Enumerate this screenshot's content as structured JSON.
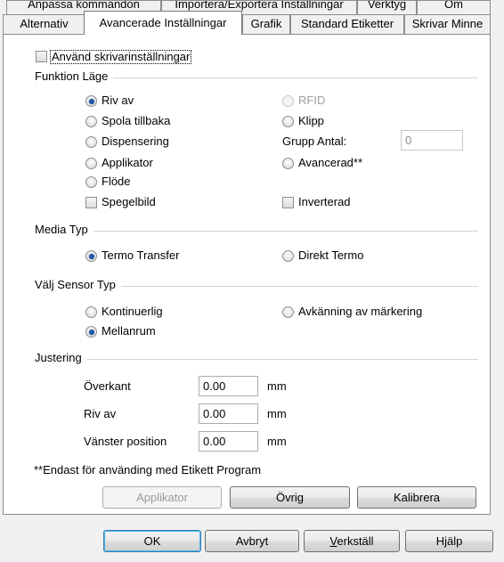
{
  "tabs_back": [
    "Anpassa kommandon",
    "Importera/Exportera Inställningar",
    "Verktyg",
    "Om"
  ],
  "tabs_front": [
    "Alternativ",
    "Avancerade Inställningar",
    "Grafik",
    "Standard Etiketter",
    "Skrivar Minne"
  ],
  "active_tab": "Avancerade Inställningar",
  "use_printer_settings": {
    "label": "Använd skrivarinställningar",
    "checked": false
  },
  "function_mode": {
    "title": "Funktion Läge",
    "options": {
      "riv_av": {
        "label": "Riv av",
        "selected": true
      },
      "spola": {
        "label": "Spola tillbaka",
        "selected": false
      },
      "dispensering": {
        "label": "Dispensering",
        "selected": false
      },
      "applikator": {
        "label": "Applikator",
        "selected": false
      },
      "flode": {
        "label": "Flöde",
        "selected": false
      },
      "rfid": {
        "label": "RFID",
        "selected": false,
        "disabled": true
      },
      "klipp": {
        "label": "Klipp",
        "selected": false
      },
      "avancerad": {
        "label": "Avancerad**",
        "selected": false
      }
    },
    "grupp_antal_label": "Grupp Antal:",
    "grupp_antal_value": "0",
    "spegelbild": {
      "label": "Spegelbild",
      "checked": false
    },
    "inverterad": {
      "label": "Inverterad",
      "checked": false
    }
  },
  "media_type": {
    "title": "Media Typ",
    "termo_transfer": {
      "label": "Termo Transfer",
      "selected": true
    },
    "direkt_termo": {
      "label": "Direkt Termo",
      "selected": false
    }
  },
  "sensor_type": {
    "title": "Välj Sensor Typ",
    "kontinuerlig": {
      "label": "Kontinuerlig",
      "selected": false
    },
    "avkanning": {
      "label": "Avkänning av märkering",
      "selected": false
    },
    "mellanrum": {
      "label": "Mellanrum",
      "selected": true
    }
  },
  "adjustment": {
    "title": "Justering",
    "overkant": {
      "label": "Överkant",
      "value": "0.00",
      "unit": "mm"
    },
    "riv_av": {
      "label": "Riv av",
      "value": "0.00",
      "unit": "mm"
    },
    "vanster": {
      "label": "Vänster position",
      "value": "0.00",
      "unit": "mm"
    }
  },
  "footnote": "**Endast för använding med Etikett Program",
  "panel_buttons": {
    "applikator": "Applikator",
    "ovrig": "Övrig",
    "kalibrera": "Kalibrera"
  },
  "dialog_buttons": {
    "ok": "OK",
    "avbryt": "Avbryt",
    "verkstall_first": "V",
    "verkstall_rest": "erkställ",
    "hjalp": "Hjälp"
  }
}
